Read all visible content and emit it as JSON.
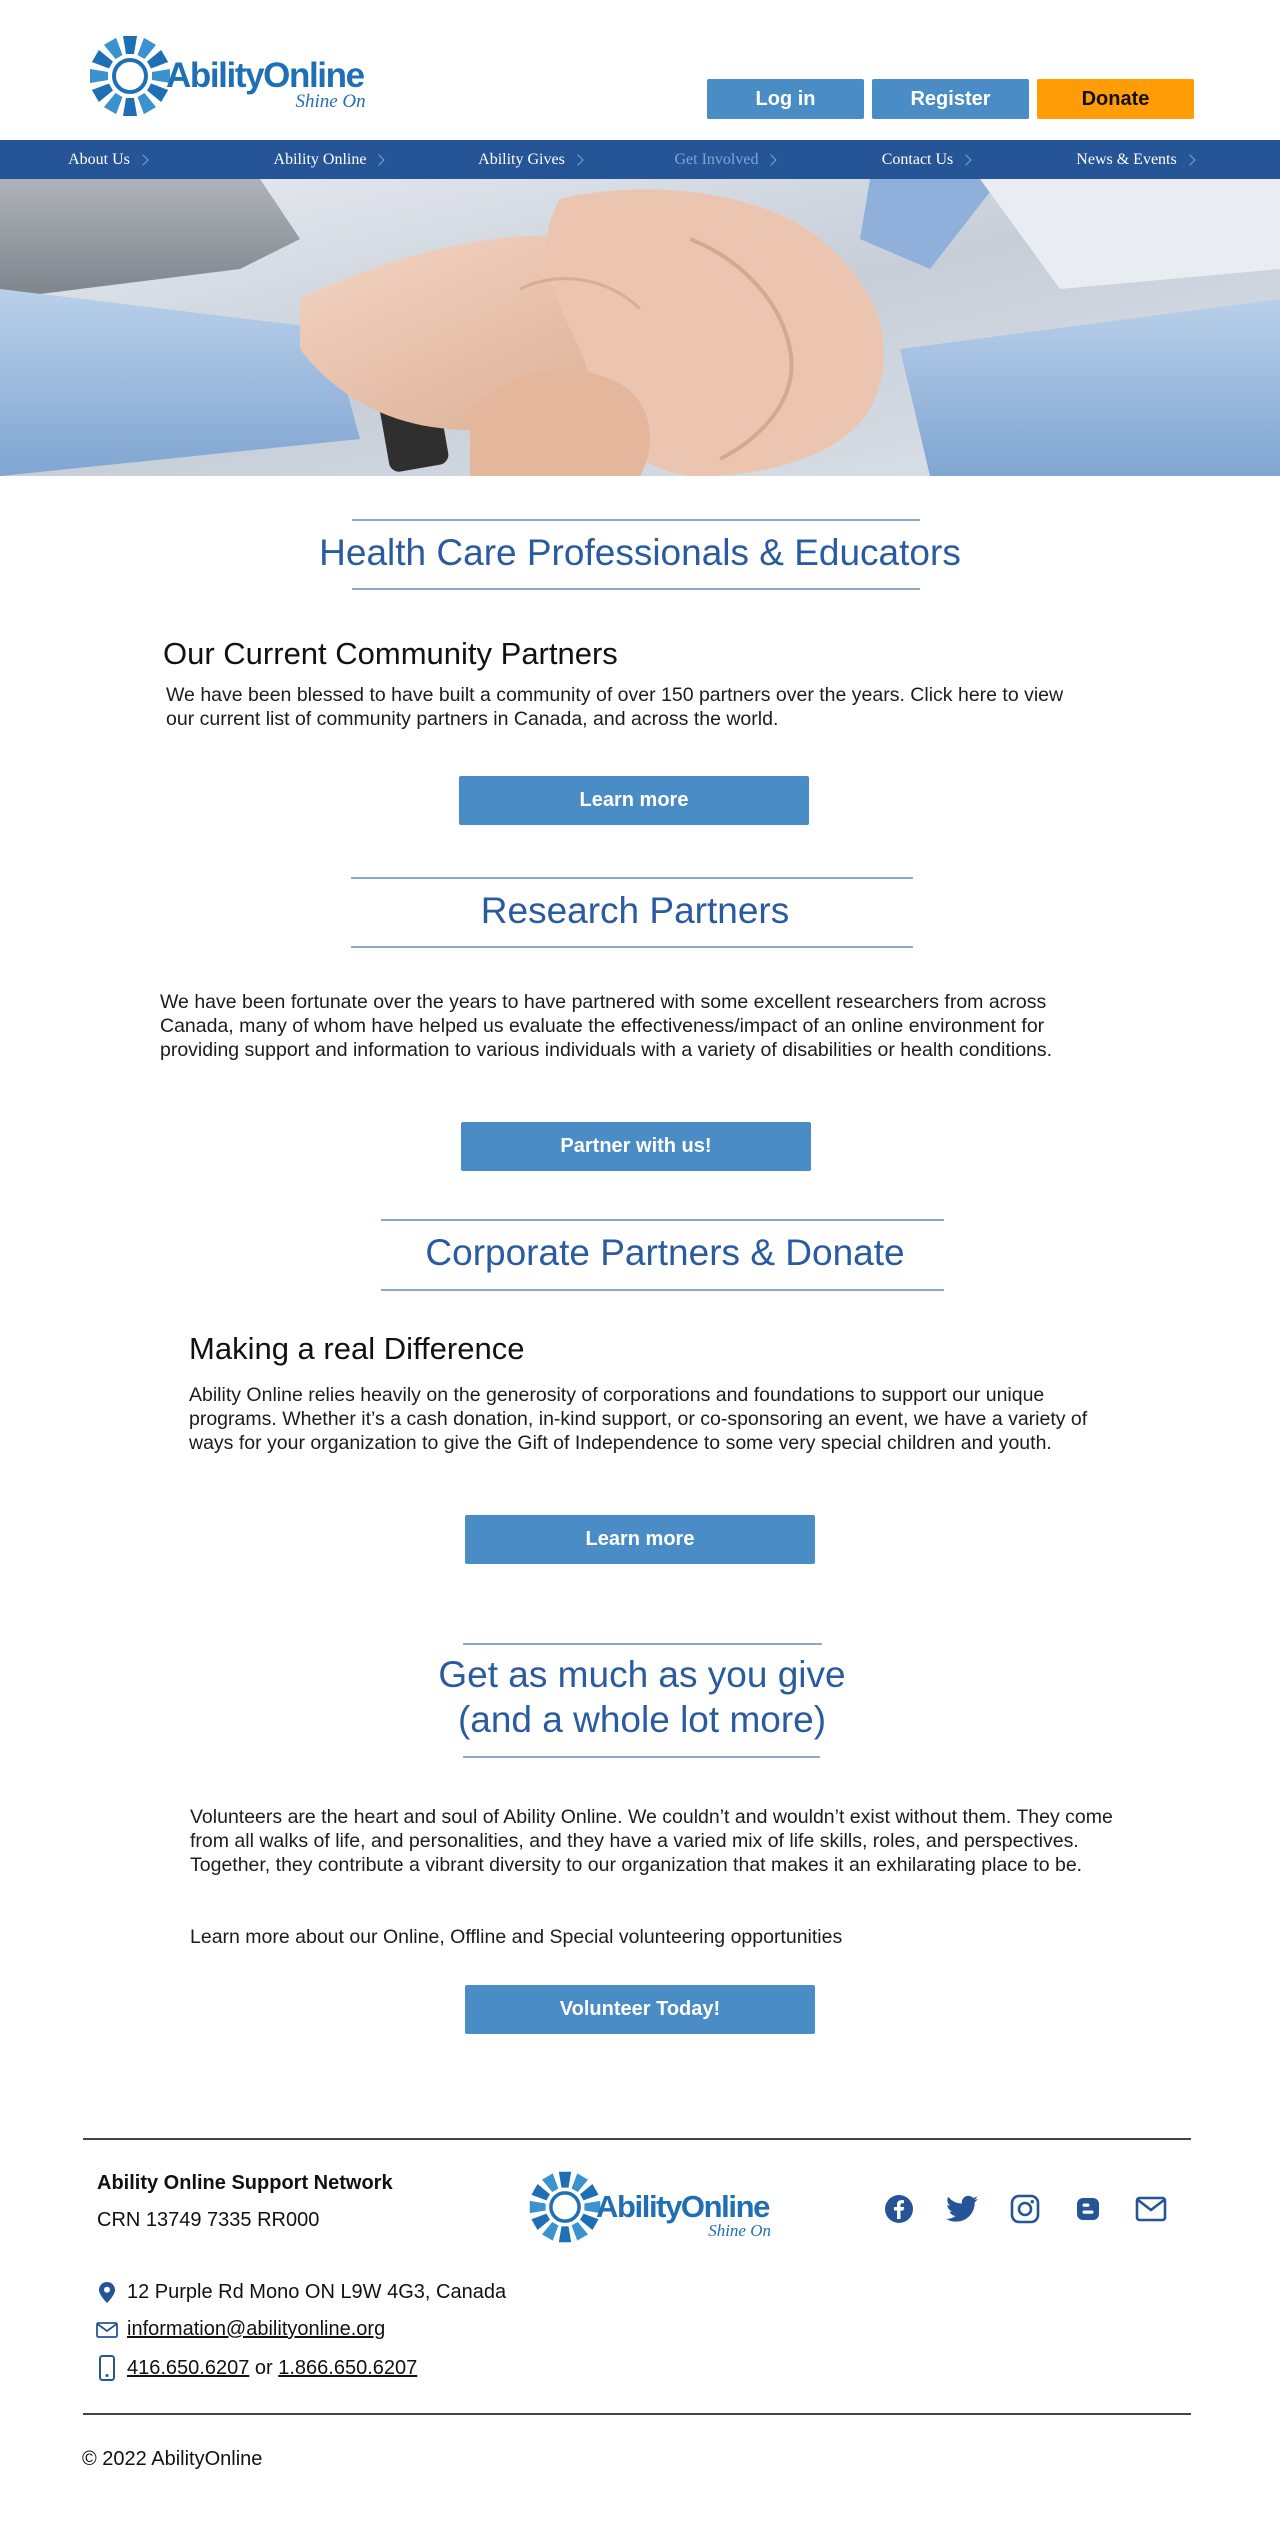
{
  "brand": {
    "name": "AbilityOnline",
    "tagline": "Shine On",
    "blue": "#1f6fb4",
    "navy": "#265597"
  },
  "header": {
    "login_label": "Log in",
    "register_label": "Register",
    "donate_label": "Donate",
    "button_color": "#4a8cc6",
    "donate_color": "#ff9c06"
  },
  "nav": {
    "items": [
      {
        "label": "About Us",
        "active": false
      },
      {
        "label": "Ability Online",
        "active": false
      },
      {
        "label": "Ability Gives",
        "active": false
      },
      {
        "label": "Get Involved",
        "active": true
      },
      {
        "label": "Contact Us",
        "active": false
      },
      {
        "label": "News & Events",
        "active": false
      }
    ]
  },
  "sections": {
    "health": {
      "title": "Health Care Professionals & Educators",
      "subtitle": "Our Current Community Partners",
      "body": "We have been blessed to have built a community of over 150 partners over the years. Click here to view our current list of community partners in Canada, and across the world.",
      "button": "Learn more"
    },
    "research": {
      "title": "Research Partners",
      "body": "We have been fortunate over the years to have partnered with some excellent researchers from across Canada, many of whom have helped us evaluate the effectiveness/impact of an online environment for providing support and information to various individuals with a variety of disabilities or health conditions.",
      "button": "Partner with us!"
    },
    "corporate": {
      "title": "Corporate Partners & Donate",
      "subtitle": "Making a real Difference",
      "body": "Ability Online relies heavily on the generosity of corporations and foundations to support our unique programs. Whether it’s a cash donation, in-kind support, or co-sponsoring an event, we have a variety of ways for your organization to give the Gift of Independence to some very special children and youth.",
      "button": "Learn more"
    },
    "volunteer": {
      "title_line1": "Get as much as you give",
      "title_line2": "(and a whole lot more)",
      "body": "Volunteers are the heart and soul of Ability Online. We couldn’t and wouldn’t exist without them. They come from all walks of life, and personalities, and they have a varied mix of life skills, roles, and perspectives. Together, they contribute a vibrant diversity to our organization that makes it an exhilarating place to be.",
      "body2": "Learn more about our Online, Offline and Special volunteering opportunities",
      "button": "Volunteer Today!"
    }
  },
  "footer": {
    "org_name": "Ability Online Support Network",
    "crn": "CRN 13749 7335 RR000",
    "address": "12 Purple Rd Mono ON L9W 4G3, Canada",
    "email": "information@abilityonline.org",
    "phone1": "416.650.6207",
    "phone_sep": " or ",
    "phone2": "1.866.650.6207",
    "socials": [
      "facebook-icon",
      "twitter-icon",
      "instagram-icon",
      "blogger-icon",
      "mail-icon"
    ],
    "copyright": "© 2022 AbilityOnline"
  }
}
